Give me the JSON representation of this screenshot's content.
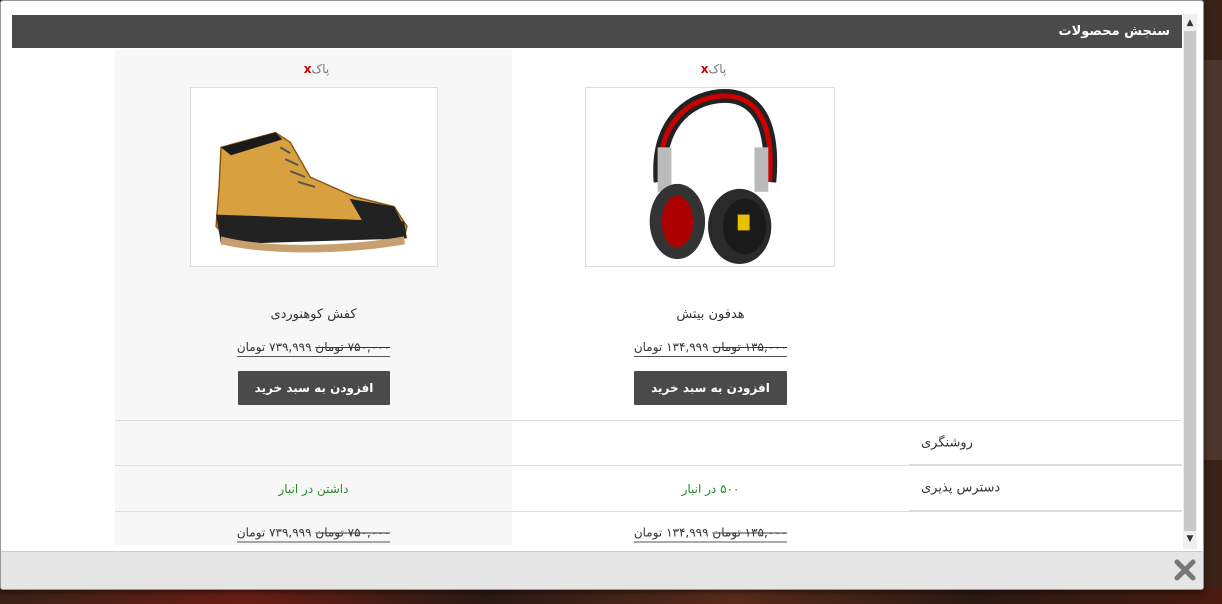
{
  "modal": {
    "title": "سنجش محصولات"
  },
  "products": [
    {
      "remove_label": "پاک",
      "remove_x": "x",
      "image": "hiking-boot",
      "name": "کفش کوهنوردی",
      "old_price": "۷۵۰,۰۰۰ تومان",
      "new_price": "۷۳۹,۹۹۹ تومان",
      "cart_label": "افزودن به سبد خرید"
    },
    {
      "remove_label": "پاک",
      "remove_x": "x",
      "image": "headphones",
      "name": "هدفون بیتش",
      "old_price": "۱۳۵,۰۰۰ تومان",
      "new_price": "۱۳۴,۹۹۹ تومان",
      "cart_label": "افزودن به سبد خرید"
    }
  ],
  "rows": [
    {
      "label": "روشنگری",
      "values": [
        "",
        ""
      ]
    },
    {
      "label": "دسترس پذیری",
      "values": [
        "داشتن در انبار",
        "۵۰۰ در انبار"
      ]
    },
    {
      "label": "",
      "values": [
        "price",
        "price"
      ]
    }
  ],
  "colors": {
    "header_bg": "#4a4a4a",
    "button_bg": "#4a4a4a",
    "stock_green": "#2a8a2a",
    "remove_red": "#cc0000"
  },
  "icons": {
    "close": "close-icon",
    "scroll_up": "chevron-up-icon",
    "scroll_down": "chevron-down-icon"
  }
}
